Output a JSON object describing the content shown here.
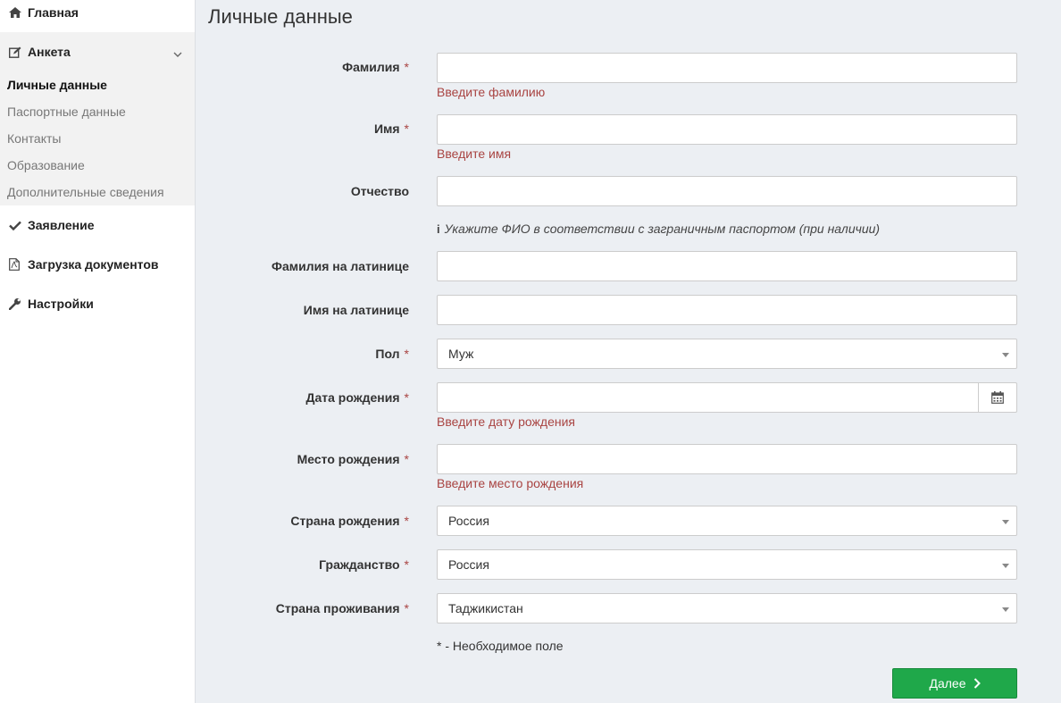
{
  "sidebar": {
    "home": {
      "label": "Главная",
      "icon": "home-icon"
    },
    "anketa": {
      "label": "Анкета",
      "icon": "edit-icon",
      "items": [
        {
          "label": "Личные данные",
          "active": true
        },
        {
          "label": "Паспортные данные"
        },
        {
          "label": "Контакты"
        },
        {
          "label": "Образование"
        },
        {
          "label": "Дополнительные сведения"
        }
      ]
    },
    "statement": {
      "label": "Заявление",
      "icon": "check-icon"
    },
    "upload": {
      "label": "Загрузка документов",
      "icon": "pdf-file-icon"
    },
    "settings": {
      "label": "Настройки",
      "icon": "wrench-icon"
    }
  },
  "page": {
    "title": "Личные данные"
  },
  "required_mark": "*",
  "form": {
    "lastname": {
      "label": "Фамилия",
      "value": "",
      "error": "Введите фамилию"
    },
    "firstname": {
      "label": "Имя",
      "value": "",
      "error": "Введите имя"
    },
    "patronymic": {
      "label": "Отчество",
      "value": ""
    },
    "hint": "Укажите ФИО в соответствии с заграничным паспортом (при наличии)",
    "lastname_latin": {
      "label": "Фамилия на латинице",
      "value": ""
    },
    "firstname_latin": {
      "label": "Имя на латинице",
      "value": ""
    },
    "gender": {
      "label": "Пол",
      "value": "Муж"
    },
    "birthdate": {
      "label": "Дата рождения",
      "value": "",
      "error": "Введите дату рождения"
    },
    "birthplace": {
      "label": "Место рождения",
      "value": "",
      "error": "Введите место рождения"
    },
    "birth_country": {
      "label": "Страна рождения",
      "value": "Россия"
    },
    "citizenship": {
      "label": "Гражданство",
      "value": "Россия"
    },
    "residence_country": {
      "label": "Страна проживания",
      "value": "Таджикистан"
    }
  },
  "required_note": "* - Необходимое поле",
  "next_button": {
    "label": "Далее"
  },
  "colors": {
    "error": "#a94442",
    "primary": "#1fa84a",
    "background": "#eceff3"
  }
}
